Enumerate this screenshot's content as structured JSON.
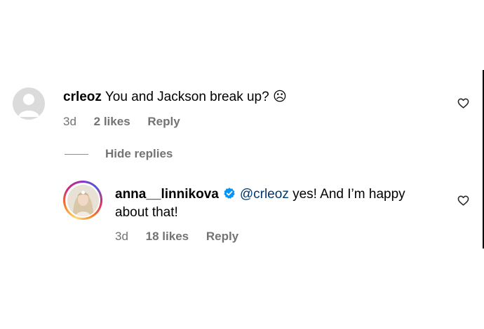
{
  "comments": [
    {
      "username": "crleoz",
      "text": "You and Jackson break up? ☹",
      "time": "3d",
      "likes": "2 likes",
      "reply_label": "Reply",
      "avatar": "default-avatar-icon"
    }
  ],
  "thread": {
    "hide_replies_label": "Hide replies"
  },
  "replies": [
    {
      "username": "anna__linnikova",
      "verified": true,
      "mention": "@crleoz",
      "text_line1": "yes! And I’m happy",
      "text_line2": "about that!",
      "time": "3d",
      "likes": "18 likes",
      "reply_label": "Reply",
      "avatar": "profile-photo"
    }
  ],
  "colors": {
    "meta_gray": "#737373",
    "mention_blue": "#00376b",
    "verified_blue": "#0095f6"
  }
}
